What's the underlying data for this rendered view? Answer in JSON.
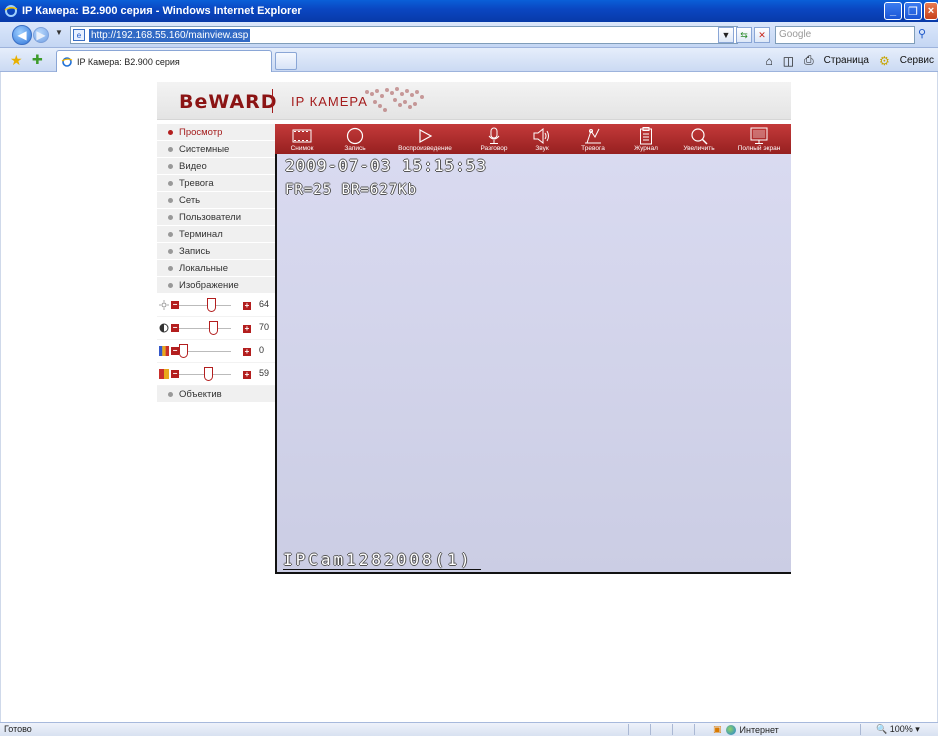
{
  "window": {
    "title": "IP Камера: B2.900 серия - Windows Internet Explorer",
    "url": "http://192.168.55.160/mainview.asp",
    "search_placeholder": "Google",
    "tab_title": "IP Камера: B2.900 серия",
    "command_page": "Страница",
    "command_tools": "Сервис"
  },
  "header": {
    "logo": "BeWARD",
    "title": "IP КАМЕРА"
  },
  "menu": {
    "items": [
      {
        "label": "Просмотр",
        "active": true
      },
      {
        "label": "Системные"
      },
      {
        "label": "Видео"
      },
      {
        "label": "Тревога"
      },
      {
        "label": "Сеть"
      },
      {
        "label": "Пользователи"
      },
      {
        "label": "Терминал"
      },
      {
        "label": "Запись"
      },
      {
        "label": "Локальные"
      },
      {
        "label": "Изображение"
      }
    ],
    "lens": "Объектив"
  },
  "sliders": {
    "brightness": {
      "icon": "brightness-icon",
      "value": "64",
      "level": 0.64
    },
    "contrast": {
      "icon": "contrast-icon",
      "value": "70",
      "level": 0.7
    },
    "saturation": {
      "icon": "saturation-icon",
      "value": "0",
      "level": 0.0
    },
    "hue": {
      "icon": "hue-icon",
      "value": "59",
      "level": 0.59
    }
  },
  "toolbar": {
    "snapshot": "Снимок",
    "record": "Запись",
    "playback": "Воспроизведение",
    "talk": "Разговор",
    "sound": "Звук",
    "alarm": "Тревога",
    "log": "Журнал",
    "zoom": "Увеличить",
    "fullscreen": "Полный экран"
  },
  "video": {
    "datetime": "2009-07-03  15:15:53",
    "stats": "FR=25  BR=627Kb",
    "camera_id": "IPCam1282008(1)"
  },
  "status": {
    "left": "Готово",
    "zone": "Интернет",
    "zoom": "100%"
  },
  "colors": {
    "brand_red": "#a41c1c",
    "toolbar_red": "#b52c2c",
    "video_bg": "#d3d4ea"
  }
}
